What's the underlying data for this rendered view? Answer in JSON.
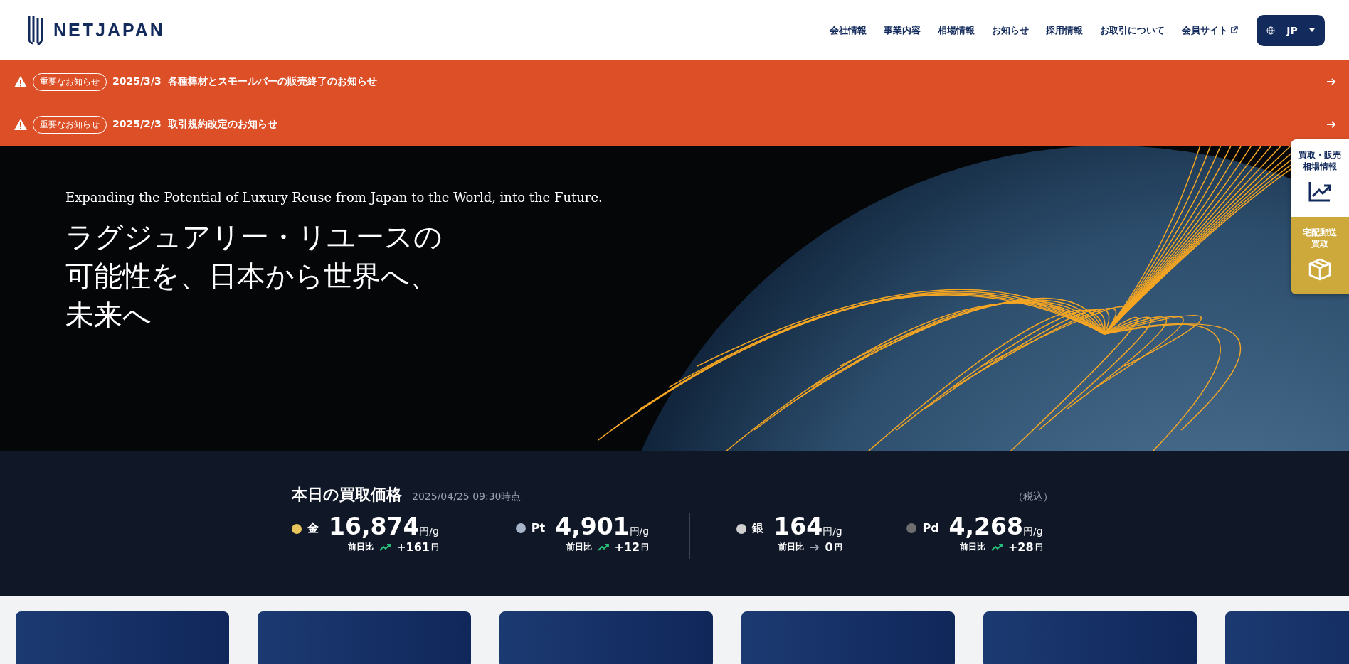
{
  "header": {
    "logo": "NETJAPAN",
    "nav": [
      {
        "label": "会社情報",
        "external": false
      },
      {
        "label": "事業内容",
        "external": false
      },
      {
        "label": "相場情報",
        "external": false
      },
      {
        "label": "お知らせ",
        "external": false
      },
      {
        "label": "採用情報",
        "external": false
      },
      {
        "label": "お取引について",
        "external": false
      },
      {
        "label": "会員サイト",
        "external": true
      }
    ],
    "language": "JP"
  },
  "alerts": [
    {
      "badge": "重要なお知らせ",
      "date": "2025/3/3",
      "title": "各種棒材とスモールバーの販売終了のお知らせ"
    },
    {
      "badge": "重要なお知らせ",
      "date": "2025/2/3",
      "title": "取引規約改定のお知らせ"
    }
  ],
  "hero": {
    "subtitle": "Expanding the Potential of Luxury Reuse from Japan to the World, into the Future.",
    "headline": [
      "ラグジュアリー・リユースの",
      "可能性を、日本から世界へ、",
      "未来へ"
    ]
  },
  "side_tabs": [
    {
      "kind": "chart",
      "label": [
        "買取・販売",
        "相場情報"
      ]
    },
    {
      "kind": "box",
      "label": [
        "宅配郵送",
        "買取"
      ]
    }
  ],
  "prices": {
    "title": "本日の買取価格",
    "timestamp": "2025/04/25 09:30時点",
    "tax_note": "（税込）",
    "items": [
      {
        "metal": "金",
        "color": "#e8c55a",
        "price": "16,874",
        "unit": "円/g",
        "change_label": "前日比",
        "rising": true,
        "change": "+161",
        "change_unit": "円"
      },
      {
        "metal": "Pt",
        "color": "#a8b4c8",
        "price": "4,901",
        "unit": "円/g",
        "change_label": "前日比",
        "rising": true,
        "change": "+12",
        "change_unit": "円"
      },
      {
        "metal": "銀",
        "color": "#d0d0d0",
        "price": "164",
        "unit": "円/g",
        "change_label": "前日比",
        "rising": false,
        "change": "0",
        "change_unit": "円"
      },
      {
        "metal": "Pd",
        "color": "#6e6e6e",
        "price": "4,268",
        "unit": "円/g",
        "change_label": "前日比",
        "rising": true,
        "change": "+28",
        "change_unit": "円"
      }
    ]
  }
}
